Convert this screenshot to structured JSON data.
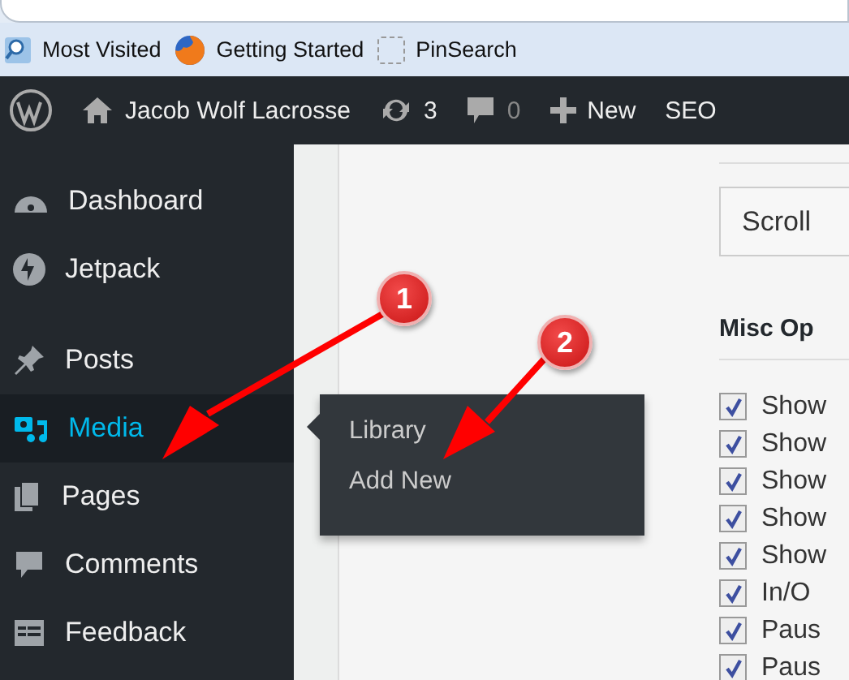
{
  "bookmarks": [
    {
      "label": "Most Visited",
      "kind": "folder"
    },
    {
      "label": "Getting Started",
      "kind": "browser"
    },
    {
      "label": "PinSearch",
      "kind": "blank"
    }
  ],
  "admin_bar": {
    "site": "Jacob Wolf Lacrosse",
    "updates": "3",
    "comments": "0",
    "new": "New",
    "seo": "SEO"
  },
  "sidebar": {
    "items": [
      {
        "label": "Dashboard",
        "kind": "gauge",
        "selected": false
      },
      {
        "label": "Jetpack",
        "kind": "bolt",
        "selected": false
      },
      {
        "label": "Posts",
        "kind": "pin",
        "selected": false
      },
      {
        "label": "Media",
        "kind": "media",
        "selected": true
      },
      {
        "label": "Pages",
        "kind": "pages",
        "selected": false
      },
      {
        "label": "Comments",
        "kind": "comment",
        "selected": false
      },
      {
        "label": "Feedback",
        "kind": "feedback",
        "selected": false
      }
    ]
  },
  "submenu": {
    "items": [
      "Library",
      "Add New"
    ]
  },
  "content": {
    "button": "Scroll",
    "section_title": "Misc Op",
    "options": [
      {
        "label": "Show",
        "checked": true
      },
      {
        "label": "Show",
        "checked": true
      },
      {
        "label": "Show",
        "checked": true
      },
      {
        "label": "Show",
        "checked": true
      },
      {
        "label": "Show",
        "checked": true
      },
      {
        "label": "In/O",
        "checked": true
      },
      {
        "label": "Paus",
        "checked": true
      },
      {
        "label": "Paus",
        "checked": true
      }
    ]
  },
  "annotations": [
    {
      "number": "1"
    },
    {
      "number": "2"
    }
  ]
}
